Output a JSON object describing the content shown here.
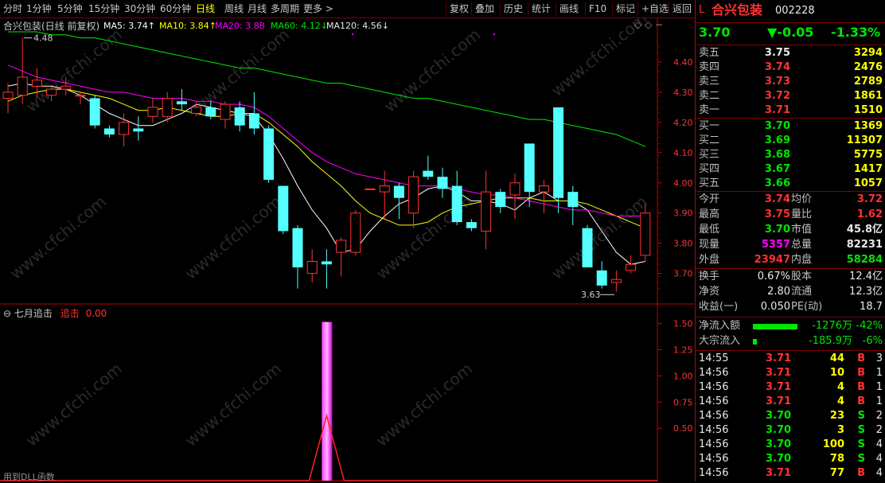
{
  "toolbar": {
    "periods": [
      "分时",
      "1分钟",
      "5分钟",
      "15分钟",
      "30分钟",
      "60分钟",
      "日线",
      "周线",
      "月线",
      "多周期",
      "更多 >"
    ],
    "active_period": "日线",
    "tools": [
      "复权",
      "叠加",
      "历史",
      "统计",
      "画线",
      "F10",
      "标记",
      "+自选",
      "返回"
    ]
  },
  "main_chart": {
    "stock_label": "合兴包装(日线 前复权)",
    "ma": [
      {
        "name": "MA5: 3.74",
        "color": "#ffffff",
        "arrow": "↑"
      },
      {
        "name": "MA10: 3.84",
        "color": "#ffff00",
        "arrow": "↑"
      },
      {
        "name": "MA20: 3.88",
        "color": "#ff00ff",
        "arrow": ""
      },
      {
        "name": "MA60: 4.12",
        "color": "#00e600",
        "arrow": "↓"
      },
      {
        "name": "MA120: 4.56",
        "color": "#e8e8e8",
        "arrow": "↓"
      }
    ],
    "ylim": [
      3.62,
      4.5
    ],
    "yticks": [
      "4.40",
      "4.30",
      "4.20",
      "4.10",
      "4.00",
      "3.90",
      "3.80",
      "3.70"
    ],
    "high_mark": "4.48",
    "low_mark": "3.63",
    "candles": [
      {
        "o": 4.28,
        "h": 4.33,
        "l": 4.23,
        "c": 4.3
      },
      {
        "o": 4.29,
        "h": 4.48,
        "l": 4.26,
        "c": 4.35
      },
      {
        "o": 4.32,
        "h": 4.38,
        "l": 4.28,
        "c": 4.34
      },
      {
        "o": 4.29,
        "h": 4.32,
        "l": 4.27,
        "c": 4.31
      },
      {
        "o": 4.31,
        "h": 4.35,
        "l": 4.29,
        "c": 4.32
      },
      {
        "o": 4.29,
        "h": 4.3,
        "l": 4.26,
        "c": 4.29
      },
      {
        "o": 4.28,
        "h": 4.29,
        "l": 4.18,
        "c": 4.19
      },
      {
        "o": 4.18,
        "h": 4.19,
        "l": 4.15,
        "c": 4.16
      },
      {
        "o": 4.16,
        "h": 4.23,
        "l": 4.12,
        "c": 4.2
      },
      {
        "o": 4.18,
        "h": 4.22,
        "l": 4.14,
        "c": 4.17
      },
      {
        "o": 4.22,
        "h": 4.28,
        "l": 4.2,
        "c": 4.25
      },
      {
        "o": 4.22,
        "h": 4.3,
        "l": 4.2,
        "c": 4.28
      },
      {
        "o": 4.27,
        "h": 4.31,
        "l": 4.24,
        "c": 4.26
      },
      {
        "o": 4.23,
        "h": 4.27,
        "l": 4.22,
        "c": 4.25
      },
      {
        "o": 4.25,
        "h": 4.27,
        "l": 4.21,
        "c": 4.22
      },
      {
        "o": 4.21,
        "h": 4.27,
        "l": 4.18,
        "c": 4.26
      },
      {
        "o": 4.25,
        "h": 4.27,
        "l": 4.17,
        "c": 4.19
      },
      {
        "o": 4.23,
        "h": 4.3,
        "l": 4.16,
        "c": 4.18
      },
      {
        "o": 4.18,
        "h": 4.19,
        "l": 4.0,
        "c": 4.01
      },
      {
        "o": 3.99,
        "h": 3.99,
        "l": 3.83,
        "c": 3.84
      },
      {
        "o": 3.85,
        "h": 3.86,
        "l": 3.65,
        "c": 3.72
      },
      {
        "o": 3.7,
        "h": 3.78,
        "l": 3.67,
        "c": 3.74
      },
      {
        "o": 3.74,
        "h": 3.78,
        "l": 3.65,
        "c": 3.73
      },
      {
        "o": 3.77,
        "h": 3.82,
        "l": 3.69,
        "c": 3.81
      },
      {
        "o": 3.77,
        "h": 3.91,
        "l": 3.76,
        "c": 3.9
      },
      {
        "o": 3.98,
        "h": 3.98,
        "l": 3.98,
        "c": 3.98
      },
      {
        "o": 3.97,
        "h": 4.04,
        "l": 3.88,
        "c": 3.99
      },
      {
        "o": 3.99,
        "h": 4.0,
        "l": 3.88,
        "c": 3.95
      },
      {
        "o": 3.9,
        "h": 4.04,
        "l": 3.85,
        "c": 4.02
      },
      {
        "o": 4.04,
        "h": 4.09,
        "l": 4.01,
        "c": 4.02
      },
      {
        "o": 4.02,
        "h": 4.05,
        "l": 3.95,
        "c": 3.98
      },
      {
        "o": 3.99,
        "h": 4.04,
        "l": 3.86,
        "c": 3.87
      },
      {
        "o": 3.87,
        "h": 3.88,
        "l": 3.84,
        "c": 3.85
      },
      {
        "o": 3.84,
        "h": 4.04,
        "l": 3.78,
        "c": 3.97
      },
      {
        "o": 3.97,
        "h": 3.98,
        "l": 3.9,
        "c": 3.92
      },
      {
        "o": 3.96,
        "h": 4.03,
        "l": 3.88,
        "c": 4.0
      },
      {
        "o": 4.13,
        "h": 4.13,
        "l": 3.92,
        "c": 3.97
      },
      {
        "o": 3.97,
        "h": 4.01,
        "l": 3.9,
        "c": 3.99
      },
      {
        "o": 4.25,
        "h": 4.25,
        "l": 3.9,
        "c": 3.95
      },
      {
        "o": 3.97,
        "h": 3.99,
        "l": 3.86,
        "c": 3.92
      },
      {
        "o": 3.85,
        "h": 3.86,
        "l": 3.72,
        "c": 3.72
      },
      {
        "o": 3.71,
        "h": 3.74,
        "l": 3.65,
        "c": 3.66
      },
      {
        "o": 3.67,
        "h": 3.71,
        "l": 3.64,
        "c": 3.68
      },
      {
        "o": 3.71,
        "h": 3.76,
        "l": 3.7,
        "c": 3.73
      },
      {
        "o": 3.76,
        "h": 3.93,
        "l": 3.74,
        "c": 3.9
      }
    ],
    "lines": {
      "MA5": [
        4.32,
        4.33,
        4.32,
        4.32,
        4.31,
        4.29,
        4.26,
        4.23,
        4.21,
        4.19,
        4.19,
        4.21,
        4.23,
        4.26,
        4.25,
        4.24,
        4.23,
        4.22,
        4.16,
        4.08,
        3.99,
        3.91,
        3.85,
        3.77,
        3.78,
        3.84,
        3.89,
        3.93,
        3.95,
        3.98,
        3.99,
        3.97,
        3.94,
        3.94,
        3.93,
        3.91,
        3.95,
        3.97,
        3.94,
        3.94,
        3.91,
        3.84,
        3.77,
        3.73,
        3.74
      ],
      "MA10": [
        4.27,
        4.29,
        4.3,
        4.31,
        4.31,
        4.3,
        4.29,
        4.28,
        4.26,
        4.24,
        4.24,
        4.25,
        4.24,
        4.23,
        4.22,
        4.22,
        4.23,
        4.23,
        4.2,
        4.16,
        4.12,
        4.07,
        4.03,
        3.99,
        3.94,
        3.9,
        3.88,
        3.86,
        3.86,
        3.87,
        3.9,
        3.92,
        3.93,
        3.94,
        3.95,
        3.95,
        3.95,
        3.94,
        3.94,
        3.94,
        3.93,
        3.91,
        3.89,
        3.87,
        3.85
      ],
      "MA20": [
        4.39,
        4.37,
        4.35,
        4.34,
        4.33,
        4.32,
        4.31,
        4.3,
        4.3,
        4.29,
        4.28,
        4.28,
        4.28,
        4.27,
        4.27,
        4.26,
        4.26,
        4.25,
        4.22,
        4.18,
        4.14,
        4.1,
        4.07,
        4.05,
        4.03,
        4.02,
        4.01,
        4.0,
        3.99,
        3.99,
        3.99,
        3.98,
        3.97,
        3.96,
        3.96,
        3.95,
        3.94,
        3.93,
        3.92,
        3.91,
        3.91,
        3.9,
        3.89,
        3.89,
        3.89
      ],
      "MA60": [
        4.5,
        4.5,
        4.5,
        4.49,
        4.49,
        4.48,
        4.48,
        4.47,
        4.46,
        4.45,
        4.44,
        4.43,
        4.42,
        4.41,
        4.4,
        4.39,
        4.38,
        4.38,
        4.37,
        4.36,
        4.35,
        4.34,
        4.33,
        4.33,
        4.32,
        4.31,
        4.3,
        4.29,
        4.28,
        4.28,
        4.27,
        4.26,
        4.25,
        4.24,
        4.23,
        4.22,
        4.21,
        4.21,
        4.2,
        4.19,
        4.18,
        4.17,
        4.16,
        4.14,
        4.12
      ]
    }
  },
  "sub_chart": {
    "title": "七月追击",
    "signal_label": "追击",
    "signal_value": "0.00",
    "yticks": [
      "1.50",
      "1.25",
      "1.00",
      "0.75",
      "0.50"
    ],
    "ylim": [
      0.0,
      1.55
    ],
    "signal_index": 22,
    "bottom_text": "用到DLL函数"
  },
  "watermark": "www.cfchi.com",
  "quote": {
    "market_letter": "L",
    "name": "合兴包装",
    "code": "002228",
    "price": "3.70",
    "change": "▼-0.05",
    "change_pct": "-1.33%",
    "asks": [
      {
        "label": "卖五",
        "price": "3.75",
        "vol": "3294"
      },
      {
        "label": "卖四",
        "price": "3.74",
        "vol": "2476"
      },
      {
        "label": "卖三",
        "price": "3.73",
        "vol": "2789"
      },
      {
        "label": "卖二",
        "price": "3.72",
        "vol": "1861"
      },
      {
        "label": "卖一",
        "price": "3.71",
        "vol": "1510"
      }
    ],
    "bids": [
      {
        "label": "买一",
        "price": "3.70",
        "vol": "1369"
      },
      {
        "label": "买二",
        "price": "3.69",
        "vol": "11307"
      },
      {
        "label": "买三",
        "price": "3.68",
        "vol": "5775"
      },
      {
        "label": "买四",
        "price": "3.67",
        "vol": "1417"
      },
      {
        "label": "买五",
        "price": "3.66",
        "vol": "1057"
      }
    ],
    "stats": [
      {
        "l1": "今开",
        "v1": "3.74",
        "c1": "red",
        "l2": "均价",
        "v2": "3.72",
        "c2": "red"
      },
      {
        "l1": "最高",
        "v1": "3.75",
        "c1": "red",
        "l2": "量比",
        "v2": "1.62",
        "c2": "red"
      },
      {
        "l1": "最低",
        "v1": "3.70",
        "c1": "green",
        "l2": "市值",
        "v2": "45.8亿",
        "c2": "white"
      },
      {
        "l1": "现量",
        "v1": "5357",
        "c1": "mag",
        "l2": "总量",
        "v2": "82231",
        "c2": "white"
      },
      {
        "l1": "外盘",
        "v1": "23947",
        "c1": "red",
        "l2": "内盘",
        "v2": "58284",
        "c2": "green"
      }
    ],
    "stats2": [
      {
        "l1": "换手",
        "v1": "0.67%",
        "l2": "股本",
        "v2": "12.4亿"
      },
      {
        "l1": "净资",
        "v1": "2.80",
        "l2": "流通",
        "v2": "12.3亿"
      },
      {
        "l1": "收益(一)",
        "v1": "0.050",
        "l2": "PE(动)",
        "v2": "18.7"
      }
    ],
    "flows": [
      {
        "label": "净流入额",
        "value": "-1276万",
        "pct": "-42%",
        "bar": 0.8
      },
      {
        "label": "大宗流入",
        "value": "-185.9万",
        "pct": "-6%",
        "bar": 0.05
      }
    ],
    "ticks": [
      {
        "t": "14:55",
        "p": "3.71",
        "v": "44",
        "s": "B",
        "n": "3"
      },
      {
        "t": "14:56",
        "p": "3.71",
        "v": "10",
        "s": "B",
        "n": "1"
      },
      {
        "t": "14:56",
        "p": "3.71",
        "v": "4",
        "s": "B",
        "n": "1"
      },
      {
        "t": "14:56",
        "p": "3.71",
        "v": "4",
        "s": "B",
        "n": "1"
      },
      {
        "t": "14:56",
        "p": "3.70",
        "v": "23",
        "s": "S",
        "n": "2"
      },
      {
        "t": "14:56",
        "p": "3.70",
        "v": "3",
        "s": "S",
        "n": "2"
      },
      {
        "t": "14:56",
        "p": "3.70",
        "v": "100",
        "s": "S",
        "n": "4"
      },
      {
        "t": "14:56",
        "p": "3.70",
        "v": "78",
        "s": "S",
        "n": "4"
      },
      {
        "t": "14:56",
        "p": "3.71",
        "v": "77",
        "s": "B",
        "n": "4"
      }
    ]
  }
}
